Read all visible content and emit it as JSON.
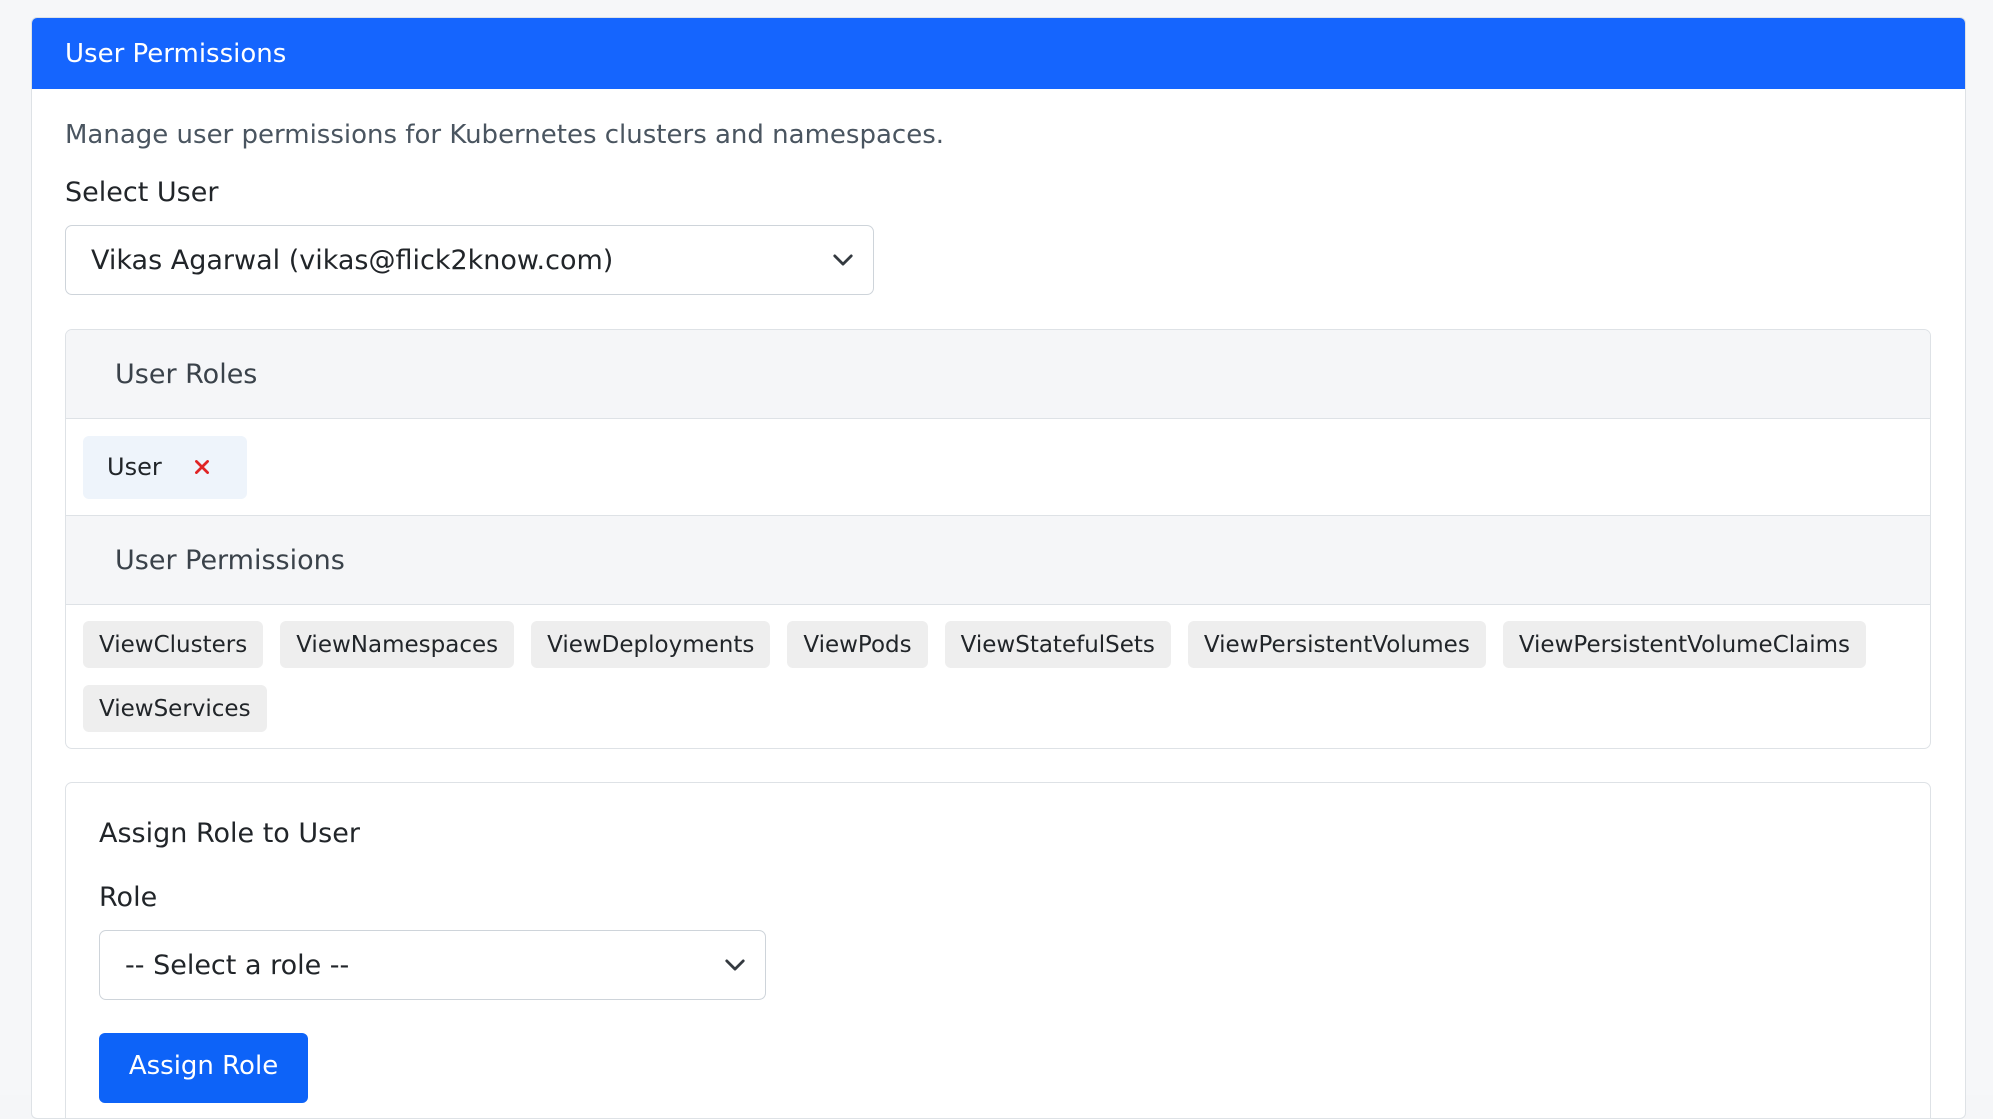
{
  "header": {
    "title": "User Permissions"
  },
  "description": "Manage user permissions for Kubernetes clusters and namespaces.",
  "select_user": {
    "label": "Select User",
    "value": "Vikas Agarwal (vikas@flick2know.com)"
  },
  "roles_panel": {
    "roles_title": "User Roles",
    "roles": [
      {
        "label": "User"
      }
    ],
    "permissions_title": "User Permissions",
    "permissions": [
      "ViewClusters",
      "ViewNamespaces",
      "ViewDeployments",
      "ViewPods",
      "ViewStatefulSets",
      "ViewPersistentVolumes",
      "ViewPersistentVolumeClaims",
      "ViewServices"
    ]
  },
  "assign_role": {
    "title": "Assign Role to User",
    "role_label": "Role",
    "role_placeholder": "-- Select a role --",
    "button_label": "Assign Role"
  },
  "icons": {
    "dropdown": "chevron-down-icon",
    "remove": "close-icon"
  },
  "colors": {
    "header_bg": "#1565fe",
    "button_bg": "#0d63f8",
    "remove_icon": "#e02424",
    "role_chip_bg": "#eef4fb",
    "permission_chip_bg": "#eeeeee"
  }
}
